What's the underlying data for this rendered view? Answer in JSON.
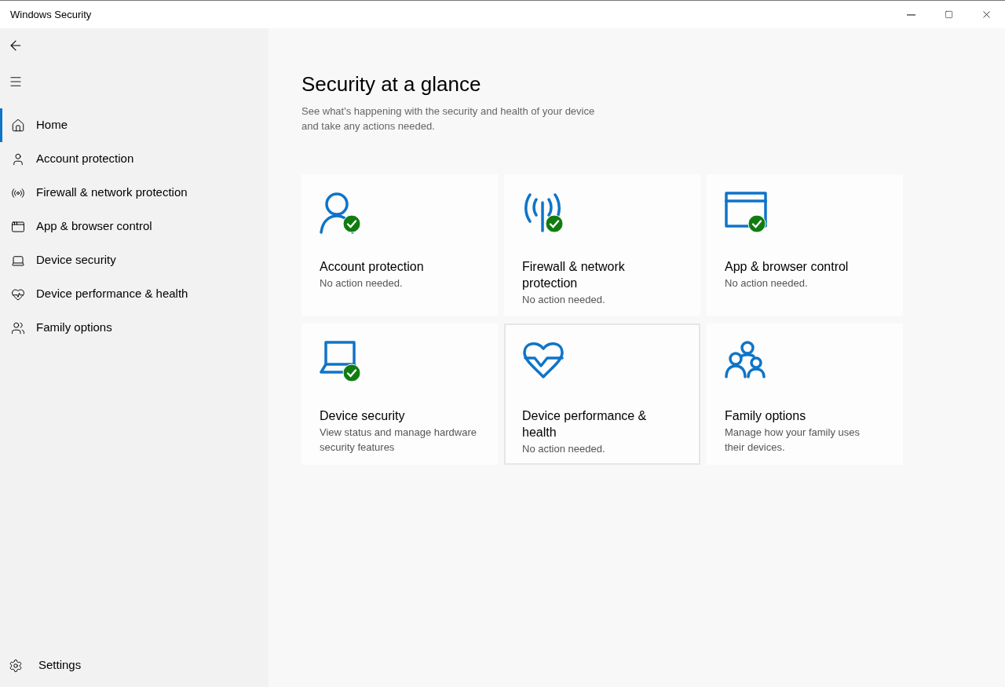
{
  "window": {
    "title": "Windows Security"
  },
  "sidebar": {
    "items": [
      {
        "kind": "home",
        "label": "Home",
        "selected": true
      },
      {
        "kind": "account",
        "label": "Account protection",
        "selected": false
      },
      {
        "kind": "firewall",
        "label": "Firewall & network protection",
        "selected": false
      },
      {
        "kind": "app",
        "label": "App & browser control",
        "selected": false
      },
      {
        "kind": "device",
        "label": "Device security",
        "selected": false
      },
      {
        "kind": "health",
        "label": "Device performance & health",
        "selected": false
      },
      {
        "kind": "family",
        "label": "Family options",
        "selected": false
      }
    ],
    "settings": {
      "label": "Settings"
    }
  },
  "page": {
    "title": "Security at a glance",
    "subtitle_lines": [
      "See what's happening with the security and health of your device",
      "and take any actions needed."
    ]
  },
  "tiles": [
    {
      "kind": "account",
      "title": "Account protection",
      "status": "No action needed.",
      "ok": true,
      "selected": false
    },
    {
      "kind": "firewall",
      "title": "Firewall & network protection",
      "status": "No action needed.",
      "ok": true,
      "selected": false
    },
    {
      "kind": "app",
      "title": "App & browser control",
      "status": "No action needed.",
      "ok": true,
      "selected": false
    },
    {
      "kind": "device",
      "title": "Device security",
      "status": "View status and manage hardware security features",
      "ok": true,
      "selected": false
    },
    {
      "kind": "health",
      "title": "Device performance & health",
      "status": "No action needed.",
      "ok": false,
      "selected": true
    },
    {
      "kind": "family",
      "title": "Family options",
      "status": "Manage how your family uses their devices.",
      "ok": false,
      "selected": false
    }
  ]
}
